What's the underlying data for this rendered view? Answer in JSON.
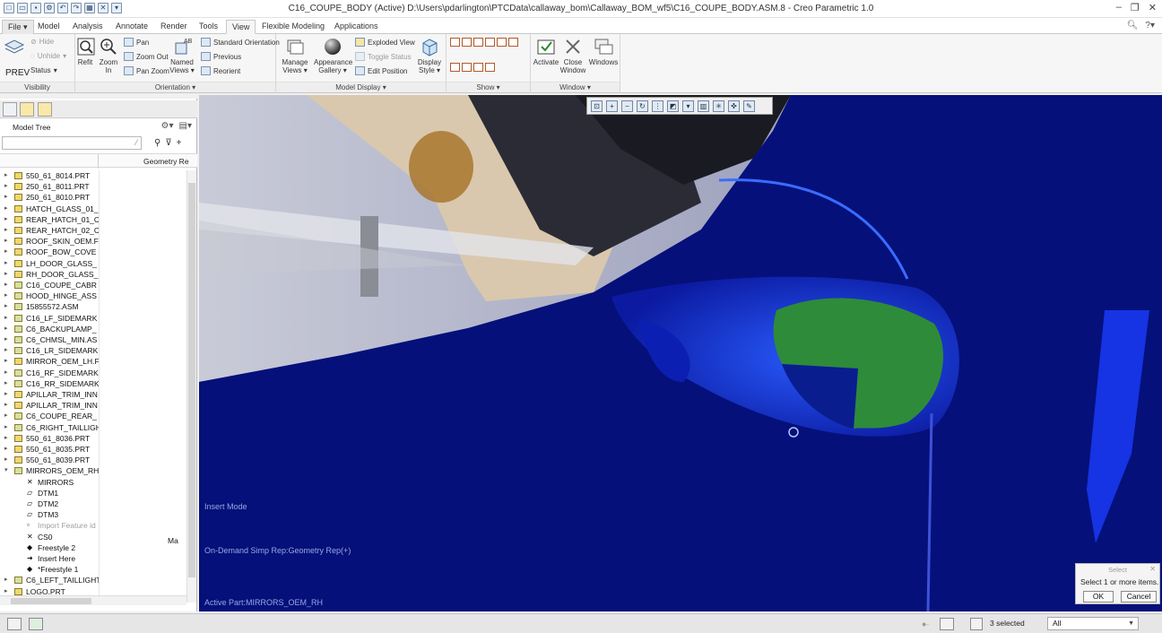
{
  "window": {
    "title": "C16_COUPE_BODY (Active) D:\\Users\\pdarlington\\PTCData\\callaway_bom\\Callaway_BOM_wf5\\C16_COUPE_BODY.ASM.8 - Creo Parametric 1.0"
  },
  "tabs": [
    {
      "label": "File ▾"
    },
    {
      "label": "Model"
    },
    {
      "label": "Analysis"
    },
    {
      "label": "Annotate"
    },
    {
      "label": "Render"
    },
    {
      "label": "Tools"
    },
    {
      "label": "View"
    },
    {
      "label": "Flexible Modeling"
    },
    {
      "label": "Applications"
    }
  ],
  "ribbon": {
    "visibility": {
      "label": "Visibility",
      "hide": "Hide",
      "unhide": "Unhide",
      "status": "Status",
      "prev": "PREV"
    },
    "orientation": {
      "label": "Orientation ▾",
      "refit": "Refit",
      "zoom_in": "Zoom In",
      "pan": "Pan",
      "zoom_out": "Zoom Out",
      "pan_zoom": "Pan Zoom",
      "named_views": "Named Views ▾",
      "standard": "Standard Orientation",
      "previous": "Previous",
      "reorient": "Reorient"
    },
    "model_display": {
      "label": "Model Display ▾",
      "manage_views": "Manage Views ▾",
      "appearance_gallery": "Appearance Gallery ▾",
      "exploded_view": "Exploded View",
      "toggle_status": "Toggle Status",
      "edit_position": "Edit Position",
      "display_style": "Display Style ▾"
    },
    "show": {
      "label": "Show ▾"
    },
    "window": {
      "label": "Window ▾",
      "activate": "Activate",
      "close_window": "Close Window",
      "windows": "Windows"
    }
  },
  "model_tree": {
    "title": "Model Tree",
    "column2": "Geometry Re",
    "extra_cell": "Ma",
    "items": [
      {
        "label": "550_61_8014.PRT",
        "type": "part"
      },
      {
        "label": "250_61_8011.PRT",
        "type": "part"
      },
      {
        "label": "250_61_8010.PRT",
        "type": "part"
      },
      {
        "label": "HATCH_GLASS_01_",
        "type": "part"
      },
      {
        "label": "REAR_HATCH_01_C",
        "type": "part"
      },
      {
        "label": "REAR_HATCH_02_C",
        "type": "part"
      },
      {
        "label": "ROOF_SKIN_OEM.F",
        "type": "part"
      },
      {
        "label": "ROOF_BOW_COVE",
        "type": "part"
      },
      {
        "label": "LH_DOOR_GLASS_",
        "type": "part"
      },
      {
        "label": "RH_DOOR_GLASS_",
        "type": "part"
      },
      {
        "label": "C16_COUPE_CABR",
        "type": "asm"
      },
      {
        "label": "HOOD_HINGE_ASS",
        "type": "asm"
      },
      {
        "label": "15855572.ASM",
        "type": "asm"
      },
      {
        "label": "C16_LF_SIDEMARK",
        "type": "asm"
      },
      {
        "label": "C6_BACKUPLAMP_",
        "type": "asm"
      },
      {
        "label": "C6_CHMSL_MIN.AS",
        "type": "asm"
      },
      {
        "label": "C16_LR_SIDEMARK",
        "type": "asm"
      },
      {
        "label": "MIRROR_OEM_LH.F",
        "type": "part"
      },
      {
        "label": "C16_RF_SIDEMARK",
        "type": "asm"
      },
      {
        "label": "C16_RR_SIDEMARK",
        "type": "asm"
      },
      {
        "label": "APILLAR_TRIM_INN",
        "type": "part"
      },
      {
        "label": "APILLAR_TRIM_INN",
        "type": "part"
      },
      {
        "label": "C6_COUPE_REAR_",
        "type": "asm"
      },
      {
        "label": "C6_RIGHT_TAILLIGH",
        "type": "asm"
      },
      {
        "label": "550_61_8036.PRT",
        "type": "part"
      },
      {
        "label": "550_61_8035.PRT",
        "type": "part"
      },
      {
        "label": "550_61_8039.PRT",
        "type": "part"
      },
      {
        "label": "MIRRORS_OEM_RH",
        "type": "expanded"
      },
      {
        "label": "MIRRORS",
        "type": "child",
        "icon": "✕"
      },
      {
        "label": "DTM1",
        "type": "child",
        "icon": "▱"
      },
      {
        "label": "DTM2",
        "type": "child",
        "icon": "▱"
      },
      {
        "label": "DTM3",
        "type": "child",
        "icon": "▱"
      },
      {
        "label": "Import Feature id",
        "type": "child-dim",
        "icon": "▫"
      },
      {
        "label": "CS0",
        "type": "child",
        "icon": "✕"
      },
      {
        "label": "Freestyle 2",
        "type": "child",
        "icon": "◆"
      },
      {
        "label": "Insert Here",
        "type": "child",
        "icon": "➜"
      },
      {
        "label": "*Freestyle 1",
        "type": "child",
        "icon": "◆"
      },
      {
        "label": "C6_LEFT_TAILLIGHT",
        "type": "asm"
      },
      {
        "label": "LOGO.PRT",
        "type": "part"
      }
    ]
  },
  "viewport": {
    "insert_mode": "Insert Mode",
    "simp_rep": "On-Demand Simp Rep:Geometry Rep(+)",
    "active_part": "Active Part:MIRRORS_OEM_RH",
    "background_color": "#05107a"
  },
  "select_dialog": {
    "title": "Select",
    "message": "Select 1 or more items.",
    "ok": "OK",
    "cancel": "Cancel"
  },
  "status": {
    "selected": "3 selected",
    "filter": "All"
  }
}
